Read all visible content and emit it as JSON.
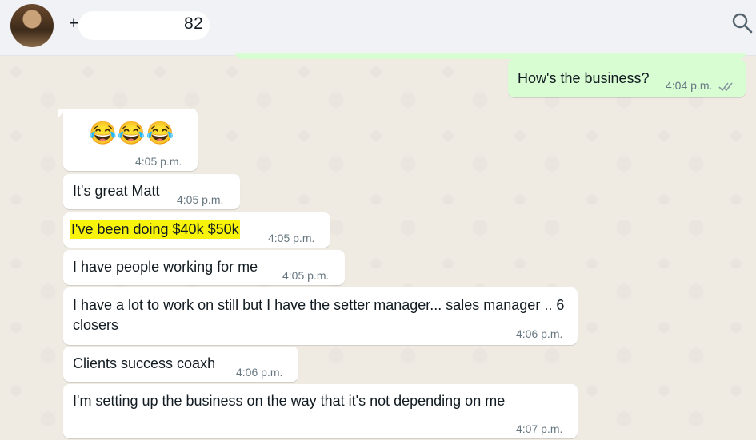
{
  "header": {
    "contact_name": "+1 (•••) •••-1-5882",
    "visible_name_prefix": "+",
    "visible_name_suffix": "1 5882"
  },
  "messages": [
    {
      "text": "How's the business?",
      "time": "4:04 p.m.",
      "direction": "out",
      "status": "read"
    },
    {
      "text": "😂😂😂",
      "time": "4:05 p.m.",
      "direction": "in"
    },
    {
      "text": "It's great Matt",
      "time": "4:05 p.m.",
      "direction": "in"
    },
    {
      "text": "I've been doing $40k $50k",
      "time": "4:05 p.m.",
      "direction": "in",
      "highlighted": true
    },
    {
      "text": "I have people working for me",
      "time": "4:05 p.m.",
      "direction": "in"
    },
    {
      "text": "I have a lot to work on still but I have the setter manager... sales manager .. 6 closers",
      "time": "4:06 p.m.",
      "direction": "in"
    },
    {
      "text": "Clients success coaxh",
      "time": "4:06 p.m.",
      "direction": "in"
    },
    {
      "text": "I'm setting up the business on the way that it's not depending on me",
      "time": "4:07 p.m.",
      "direction": "in"
    }
  ],
  "colors": {
    "chat_bg": "#efeae2",
    "outgoing_bubble": "#d9fdd3",
    "incoming_bubble": "#ffffff",
    "highlight": "#f7f30a",
    "read_check": "#8696a0"
  },
  "icons": {
    "search": "search-icon",
    "read_receipt": "double-check-icon"
  }
}
